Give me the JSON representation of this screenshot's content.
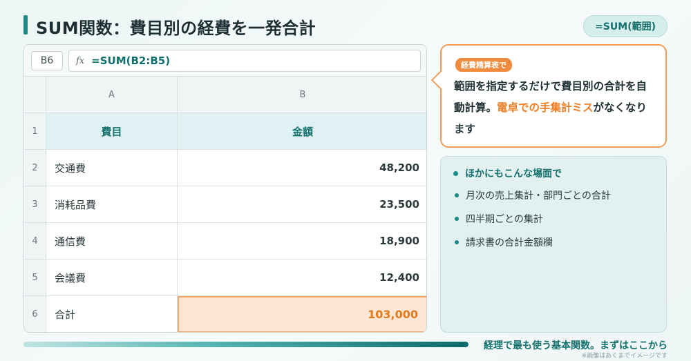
{
  "title": "SUM関数：費目別の経費を一発合計",
  "formula_badge": "=SUM(範囲)",
  "sheet": {
    "name_box": "B6",
    "fx_label": "fx",
    "formula": "=SUM(B2:B5)",
    "col_headers": [
      "A",
      "B"
    ],
    "rows": [
      {
        "num": "1",
        "a": "費目",
        "b": "金額"
      },
      {
        "num": "2",
        "a": "交通費",
        "b": "48,200"
      },
      {
        "num": "3",
        "a": "消耗品費",
        "b": "23,500"
      },
      {
        "num": "4",
        "a": "通信費",
        "b": "18,900"
      },
      {
        "num": "5",
        "a": "会議費",
        "b": "12,400"
      },
      {
        "num": "6",
        "a": "合計",
        "b": "103,000"
      }
    ]
  },
  "callout": {
    "tag": "経費精算表で",
    "text_1": "範囲を指定するだけで費目別の合計を自動計算。",
    "highlight": "電卓での手集計ミス",
    "text_2": "がなくなります"
  },
  "tips": {
    "title": "ほかにもこんな場面で",
    "items": [
      "月次の売上集計・部門ごとの合計",
      "四半期ごとの集計",
      "請求書の合計金額欄"
    ]
  },
  "footer": {
    "progress": 1.0,
    "text": "経理で最も使う基本関数。まずはここから",
    "note": "※画像はあくまでイメージです"
  },
  "colors": {
    "accent": "#1a8a86",
    "highlight": "#ee7d22"
  }
}
